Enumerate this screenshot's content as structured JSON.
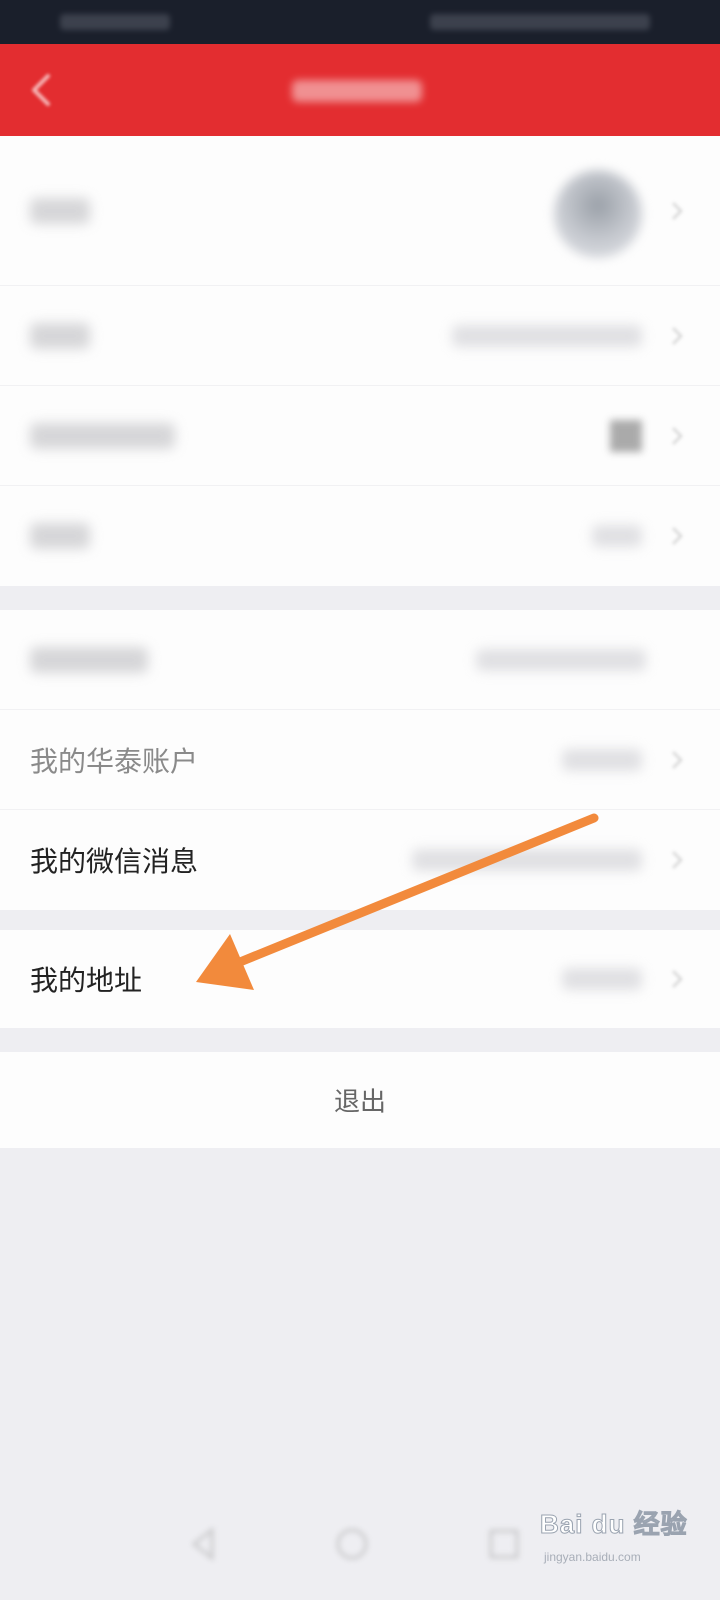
{
  "settings": {
    "wallet_row_label": "我的华泰账户",
    "wechat_row_label": "我的微信消息",
    "address_row_label": "我的地址"
  },
  "logout": {
    "label": "退出"
  },
  "watermark": {
    "brand": "Bai du 经验",
    "url": "jingyan.baidu.com"
  },
  "colors": {
    "header": "#e32d30",
    "arrow": "#f28a3c"
  }
}
